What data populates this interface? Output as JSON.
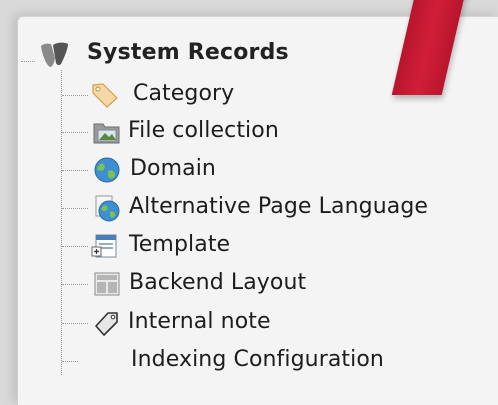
{
  "tree": {
    "root": {
      "label": "System Records",
      "icon": "typo3-logo-icon"
    },
    "items": [
      {
        "label": "Category",
        "icon": "category-tag-icon"
      },
      {
        "label": "File collection",
        "icon": "file-collection-folder-icon"
      },
      {
        "label": "Domain",
        "icon": "domain-globe-icon"
      },
      {
        "label": "Alternative Page Language",
        "icon": "page-language-globe-icon"
      },
      {
        "label": "Template",
        "icon": "template-icon"
      },
      {
        "label": "Backend Layout",
        "icon": "backend-layout-icon"
      },
      {
        "label": "Internal note",
        "icon": "internal-note-tag-icon"
      },
      {
        "label": "Indexing Configuration",
        "icon": ""
      }
    ]
  },
  "colors": {
    "ribbon": "#c81a32",
    "panel": "#f4f4f4"
  }
}
